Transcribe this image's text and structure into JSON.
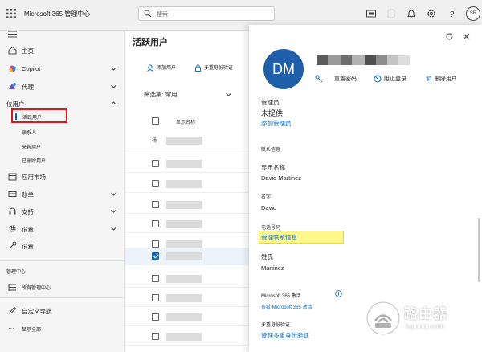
{
  "topbar": {
    "app_title": "Microsoft 365 管理中心",
    "search_placeholder": "搜索",
    "avatar_initials": "SR"
  },
  "sidebar": {
    "items": [
      {
        "label": "主页",
        "icon": "home-icon"
      },
      {
        "label": "Copilot",
        "icon": "copilot-icon"
      },
      {
        "label": "代理",
        "icon": "agent-icon"
      },
      {
        "label": "位用户",
        "icon": "user-icon"
      },
      {
        "label": "应用市场",
        "icon": "marketplace-icon"
      },
      {
        "label": "账单",
        "icon": "billing-icon"
      },
      {
        "label": "支持",
        "icon": "support-icon"
      },
      {
        "label": "设置",
        "icon": "settings-icon"
      },
      {
        "label": "设置",
        "icon": "setup-icon"
      }
    ],
    "users_subitems": [
      "活跃用户",
      "联系人",
      "来宾用户",
      "已删除用户"
    ],
    "section_admin_centers": "管理中心",
    "all_admin_centers": "所有管理中心",
    "customize_nav": "自定义导航",
    "show_all": "显示全部"
  },
  "main": {
    "page_title": "活跃用户",
    "cmd_add_user": "添加用户",
    "cmd_mfa": "多重身份验证",
    "filter_label": "筛选集: 常用",
    "col_display_name": "显示名称 ↑",
    "first_row_text": "杨"
  },
  "panel": {
    "avatar_initials": "DM",
    "action_reset_password": "重置密码",
    "action_block_signin": "阻止登录",
    "action_delete_prefix": "和",
    "action_delete": "删除用户",
    "roles_label": "管理员",
    "roles_value": "未提供",
    "roles_link": "添加管理员",
    "contact_header": "联系信息",
    "display_name_label": "显示名称",
    "display_name_value": "David Martinez",
    "first_name_label": "名字",
    "first_name_value": "David",
    "phone_label": "电话号码",
    "phone_link": "管理联系信息",
    "last_name_label": "姓氏",
    "last_name_value": "Martinez",
    "ms365_label": "Microsoft 365 激活",
    "ms365_link": "查看 Microsoft 365 激活",
    "mfa_label": "多重身份验证",
    "mfa_link": "管理多重身份验证"
  },
  "watermark": {
    "title": "路由器",
    "url": "luyouqi.com"
  },
  "colors": {
    "accent": "#0f6cbd",
    "avatar_bg": "#1f5ea8",
    "highlight": "#fff78a",
    "callout_border": "#e3141c"
  }
}
